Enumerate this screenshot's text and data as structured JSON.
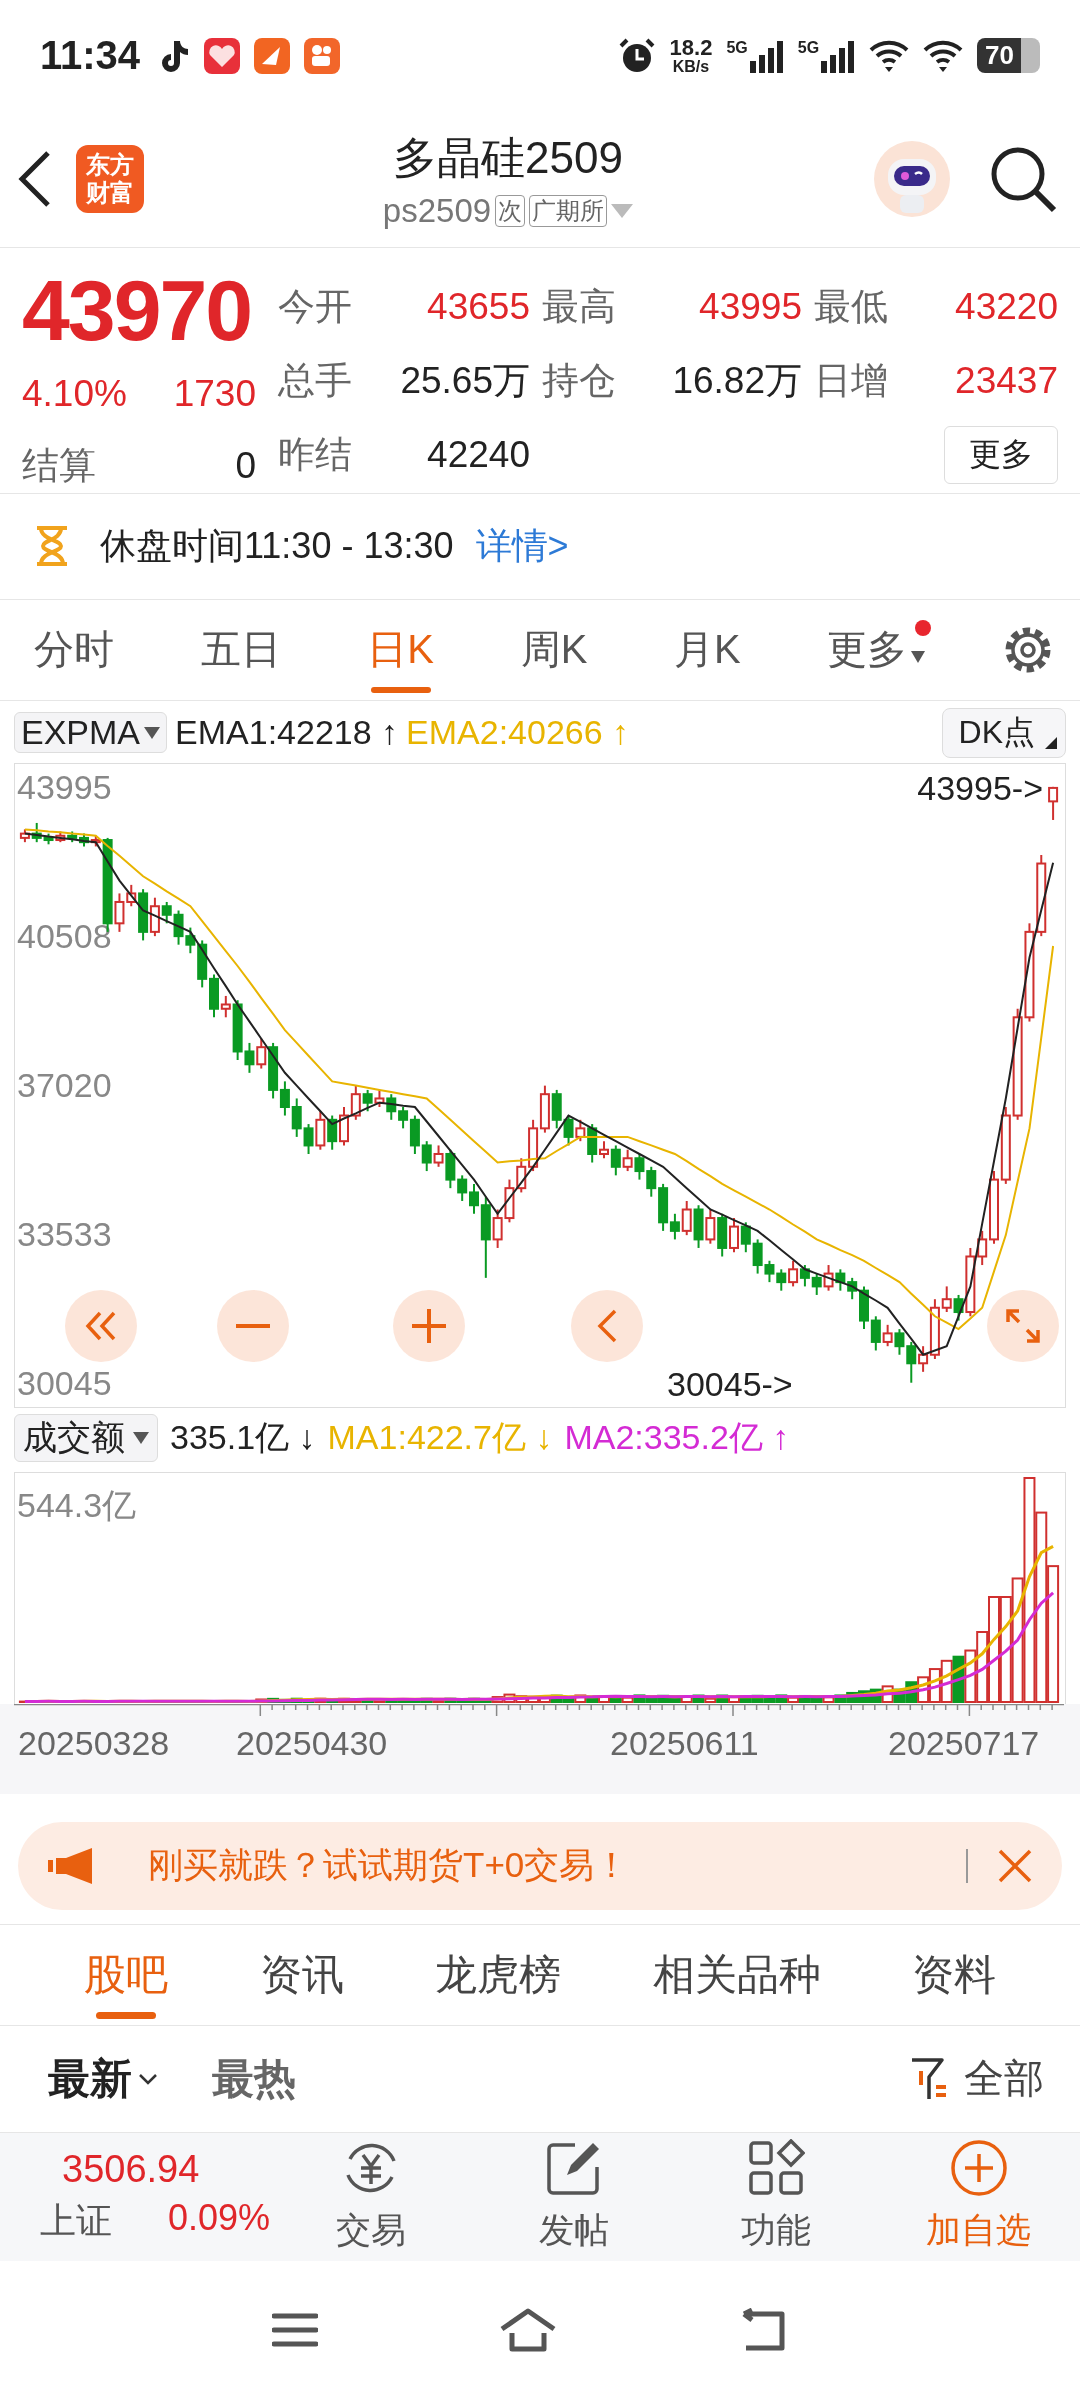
{
  "status_bar": {
    "time": "11:34",
    "net_speed": "18.2",
    "net_speed_unit": "KB/s",
    "networks": [
      "5G",
      "5G"
    ],
    "battery": "70"
  },
  "header": {
    "logo": [
      "东方",
      "财富"
    ],
    "title": "多晶硅2509",
    "code": "ps2509",
    "tags": [
      "次",
      "广期所"
    ]
  },
  "quote": {
    "price": "43970",
    "change_percent": "4.10%",
    "change": "1730",
    "settlement": {
      "label": "结算",
      "value": "0"
    },
    "fields": [
      {
        "label": "今开",
        "value": "43655",
        "color": "#e0262a"
      },
      {
        "label": "最高",
        "value": "43995",
        "color": "#e0262a"
      },
      {
        "label": "最低",
        "value": "43220",
        "color": "#e0262a"
      },
      {
        "label": "总手",
        "value": "25.65万",
        "color": "#222222"
      },
      {
        "label": "持仓",
        "value": "16.82万",
        "color": "#222222"
      },
      {
        "label": "日增",
        "value": "23437",
        "color": "#e0262a"
      },
      {
        "label": "昨结",
        "value": "42240",
        "color": "#222222"
      }
    ],
    "more_button": "更多"
  },
  "notice": {
    "text": "休盘时间11:30 - 13:30",
    "link": "详情>"
  },
  "chart_tabs": [
    {
      "label": "分时",
      "selected": false,
      "dot": false,
      "dropdown": false
    },
    {
      "label": "五日",
      "selected": false,
      "dot": false,
      "dropdown": false
    },
    {
      "label": "日K",
      "selected": true,
      "dot": false,
      "dropdown": false
    },
    {
      "label": "周K",
      "selected": false,
      "dot": false,
      "dropdown": false
    },
    {
      "label": "月K",
      "selected": false,
      "dot": false,
      "dropdown": false
    },
    {
      "label": "更多",
      "selected": false,
      "dot": true,
      "dropdown": true
    }
  ],
  "indicator": {
    "selector": "EXPMA",
    "legend": [
      {
        "text": ":42218 ↑",
        "color": "#222222"
      },
      {
        "text": ":40266 ↑",
        "color": "#e8b400"
      }
    ],
    "button": "DK点"
  },
  "kline": {
    "chart_data": {
      "type": "candlestick",
      "ylim": [
        29500,
        44530
      ],
      "yticks": [
        43995,
        40508,
        37020,
        33533,
        30045
      ],
      "ohlc": [
        [
          42800,
          43000,
          42700,
          42900
        ],
        [
          42900,
          43150,
          42700,
          42800
        ],
        [
          42800,
          42900,
          42650,
          42750
        ],
        [
          42750,
          42950,
          42700,
          42850
        ],
        [
          42850,
          42950,
          42700,
          42800
        ],
        [
          42800,
          42900,
          42600,
          42700
        ],
        [
          42700,
          42850,
          42600,
          42750
        ],
        [
          42750,
          42800,
          40600,
          40800
        ],
        [
          40800,
          41500,
          40600,
          41300
        ],
        [
          41300,
          41700,
          41200,
          41500
        ],
        [
          41500,
          41600,
          40400,
          40600
        ],
        [
          40600,
          41400,
          40500,
          41200
        ],
        [
          41200,
          41300,
          40800,
          41000
        ],
        [
          41000,
          41100,
          40300,
          40500
        ],
        [
          40500,
          40700,
          40100,
          40300
        ],
        [
          40300,
          40400,
          39300,
          39500
        ],
        [
          39500,
          39600,
          38600,
          38800
        ],
        [
          38800,
          39100,
          38600,
          38900
        ],
        [
          38900,
          39000,
          37600,
          37800
        ],
        [
          37800,
          38000,
          37300,
          37500
        ],
        [
          37500,
          38100,
          37400,
          37900
        ],
        [
          37900,
          38000,
          36700,
          36900
        ],
        [
          36900,
          37100,
          36300,
          36500
        ],
        [
          36500,
          36700,
          35800,
          36000
        ],
        [
          36000,
          36100,
          35400,
          35600
        ],
        [
          35600,
          36400,
          35500,
          36200
        ],
        [
          36200,
          36300,
          35500,
          35700
        ],
        [
          35700,
          36500,
          35600,
          36300
        ],
        [
          36300,
          37000,
          36200,
          36800
        ],
        [
          36800,
          36900,
          36400,
          36600
        ],
        [
          36600,
          36900,
          36500,
          36700
        ],
        [
          36700,
          36800,
          36200,
          36400
        ],
        [
          36400,
          36500,
          36000,
          36200
        ],
        [
          36200,
          36300,
          35400,
          35600
        ],
        [
          35600,
          35700,
          35000,
          35200
        ],
        [
          35200,
          35600,
          35100,
          35400
        ],
        [
          35400,
          35500,
          34600,
          34800
        ],
        [
          34800,
          34900,
          34300,
          34500
        ],
        [
          34500,
          34700,
          34000,
          34200
        ],
        [
          34200,
          34400,
          32500,
          33400
        ],
        [
          33400,
          34100,
          33200,
          33900
        ],
        [
          33900,
          34800,
          33800,
          34600
        ],
        [
          34600,
          35300,
          34500,
          35100
        ],
        [
          35100,
          36200,
          35000,
          36000
        ],
        [
          36000,
          37000,
          35900,
          36800
        ],
        [
          36800,
          36900,
          36000,
          36200
        ],
        [
          36200,
          36300,
          35600,
          35800
        ],
        [
          35800,
          36200,
          35700,
          36000
        ],
        [
          36000,
          36100,
          35200,
          35400
        ],
        [
          35400,
          35700,
          35300,
          35500
        ],
        [
          35500,
          35600,
          34900,
          35100
        ],
        [
          35100,
          35500,
          35000,
          35300
        ],
        [
          35300,
          35400,
          34800,
          35000
        ],
        [
          35000,
          35100,
          34400,
          34600
        ],
        [
          34600,
          34700,
          33600,
          33800
        ],
        [
          33800,
          34000,
          33400,
          33600
        ],
        [
          33600,
          34300,
          33500,
          34100
        ],
        [
          34100,
          34200,
          33200,
          33400
        ],
        [
          33400,
          34100,
          33300,
          33900
        ],
        [
          33900,
          34000,
          33000,
          33200
        ],
        [
          33200,
          33900,
          33100,
          33700
        ],
        [
          33700,
          33800,
          33100,
          33300
        ],
        [
          33300,
          33400,
          32600,
          32800
        ],
        [
          32800,
          32900,
          32400,
          32600
        ],
        [
          32600,
          32700,
          32200,
          32400
        ],
        [
          32400,
          32900,
          32300,
          32700
        ],
        [
          32700,
          32800,
          32300,
          32500
        ],
        [
          32500,
          32600,
          32100,
          32300
        ],
        [
          32300,
          32800,
          32200,
          32600
        ],
        [
          32600,
          32700,
          32200,
          32400
        ],
        [
          32400,
          32500,
          32000,
          32200
        ],
        [
          32200,
          32300,
          31300,
          31500
        ],
        [
          31500,
          31600,
          30800,
          31000
        ],
        [
          31000,
          31400,
          30900,
          31200
        ],
        [
          31200,
          31300,
          30700,
          30900
        ],
        [
          30900,
          31000,
          30045,
          30500
        ],
        [
          30500,
          30900,
          30300,
          30700
        ],
        [
          30700,
          32000,
          30600,
          31800
        ],
        [
          31800,
          32300,
          31700,
          32000
        ],
        [
          32000,
          32100,
          31500,
          31700
        ],
        [
          31700,
          33200,
          31600,
          33000
        ],
        [
          33000,
          33600,
          32800,
          33400
        ],
        [
          33400,
          35000,
          33300,
          34800
        ],
        [
          34800,
          36500,
          34700,
          36300
        ],
        [
          36300,
          38800,
          36200,
          38600
        ],
        [
          38600,
          40800,
          38500,
          40600
        ],
        [
          40600,
          42400,
          40500,
          42200
        ],
        [
          43655,
          43995,
          43220,
          43970
        ]
      ],
      "series": [
        {
          "name": "EMA1",
          "type": "line",
          "color": "#222222",
          "values": [
            42900,
            42870,
            42830,
            42800,
            42770,
            42730,
            42700,
            42250,
            41800,
            41450,
            41100,
            40980,
            40850,
            40730,
            40600,
            40180,
            39750,
            39330,
            38900,
            38500,
            38100,
            37700,
            37300,
            37000,
            36700,
            36400,
            36100,
            36230,
            36350,
            36480,
            36600,
            36570,
            36530,
            36500,
            36160,
            35820,
            35480,
            35140,
            34800,
            34400,
            34000,
            34370,
            34730,
            35100,
            35500,
            35900,
            36300,
            36150,
            36000,
            35850,
            35700,
            35550,
            35400,
            35250,
            35100,
            34850,
            34600,
            34350,
            34100,
            33980,
            33850,
            33730,
            33600,
            33380,
            33150,
            32930,
            32700,
            32600,
            32500,
            32400,
            32300,
            32130,
            31970,
            31800,
            31430,
            31070,
            30700,
            30800,
            30900,
            31600,
            32300,
            33770,
            35230,
            36700,
            38350,
            40000,
            41110,
            42220
          ]
        },
        {
          "name": "EMA2",
          "type": "line",
          "color": "#e8b400",
          "values": [
            43000,
            42980,
            42950,
            42930,
            42900,
            42880,
            42850,
            42610,
            42380,
            42140,
            41900,
            41730,
            41550,
            41380,
            41200,
            40850,
            40500,
            40150,
            39800,
            39430,
            39050,
            38680,
            38300,
            38000,
            37700,
            37400,
            37100,
            37050,
            37000,
            36950,
            36900,
            36850,
            36800,
            36750,
            36700,
            36450,
            36200,
            35950,
            35700,
            35450,
            35200,
            35230,
            35250,
            35280,
            35300,
            35470,
            35630,
            35800,
            35800,
            35800,
            35800,
            35800,
            35700,
            35600,
            35500,
            35400,
            35230,
            35050,
            34880,
            34700,
            34550,
            34400,
            34250,
            34100,
            33930,
            33750,
            33580,
            33400,
            33280,
            33150,
            33030,
            32900,
            32730,
            32570,
            32400,
            32130,
            31870,
            31600,
            31450,
            31300,
            31550,
            31800,
            32650,
            33500,
            34750,
            36000,
            38130,
            40270
          ]
        }
      ]
    }
  },
  "high_marker": "43995->",
  "low_marker": "30045->",
  "volume": {
    "selector": "成交额",
    "legend": [
      {
        "text": "335.1亿 ↓",
        "color": "#222222"
      },
      {
        "text": "MA1:422.7亿 ↓",
        "color": "#e8b400"
      },
      {
        "text": "MA2:335.2亿 ↑",
        "color": "#d42bd4"
      }
    ],
    "axis_max": "544.3亿"
  },
  "dates": [
    "20250328",
    "20250430",
    "20250611",
    "20250717"
  ],
  "banner": "刚买就跌？试试期货T+0交易！",
  "section_tabs": [
    {
      "label": "股吧",
      "selected": true
    },
    {
      "label": "资讯",
      "selected": false
    },
    {
      "label": "龙虎榜",
      "selected": false
    },
    {
      "label": "相关品种",
      "selected": false
    },
    {
      "label": "资料",
      "selected": false
    }
  ],
  "sort_tabs": [
    {
      "label": "最新",
      "selected": true
    },
    {
      "label": "最热",
      "selected": false
    }
  ],
  "filter": "全部",
  "index": {
    "value": "3506.94",
    "name": "上证",
    "change": "0.09%"
  },
  "actions": [
    {
      "kind": "trade",
      "label": "交易",
      "color": "#555555"
    },
    {
      "kind": "post",
      "label": "发帖",
      "color": "#555555"
    },
    {
      "kind": "functions",
      "label": "功能",
      "color": "#555555"
    },
    {
      "kind": "watchlist",
      "label": "加自选",
      "color": "#e8600f"
    }
  ]
}
